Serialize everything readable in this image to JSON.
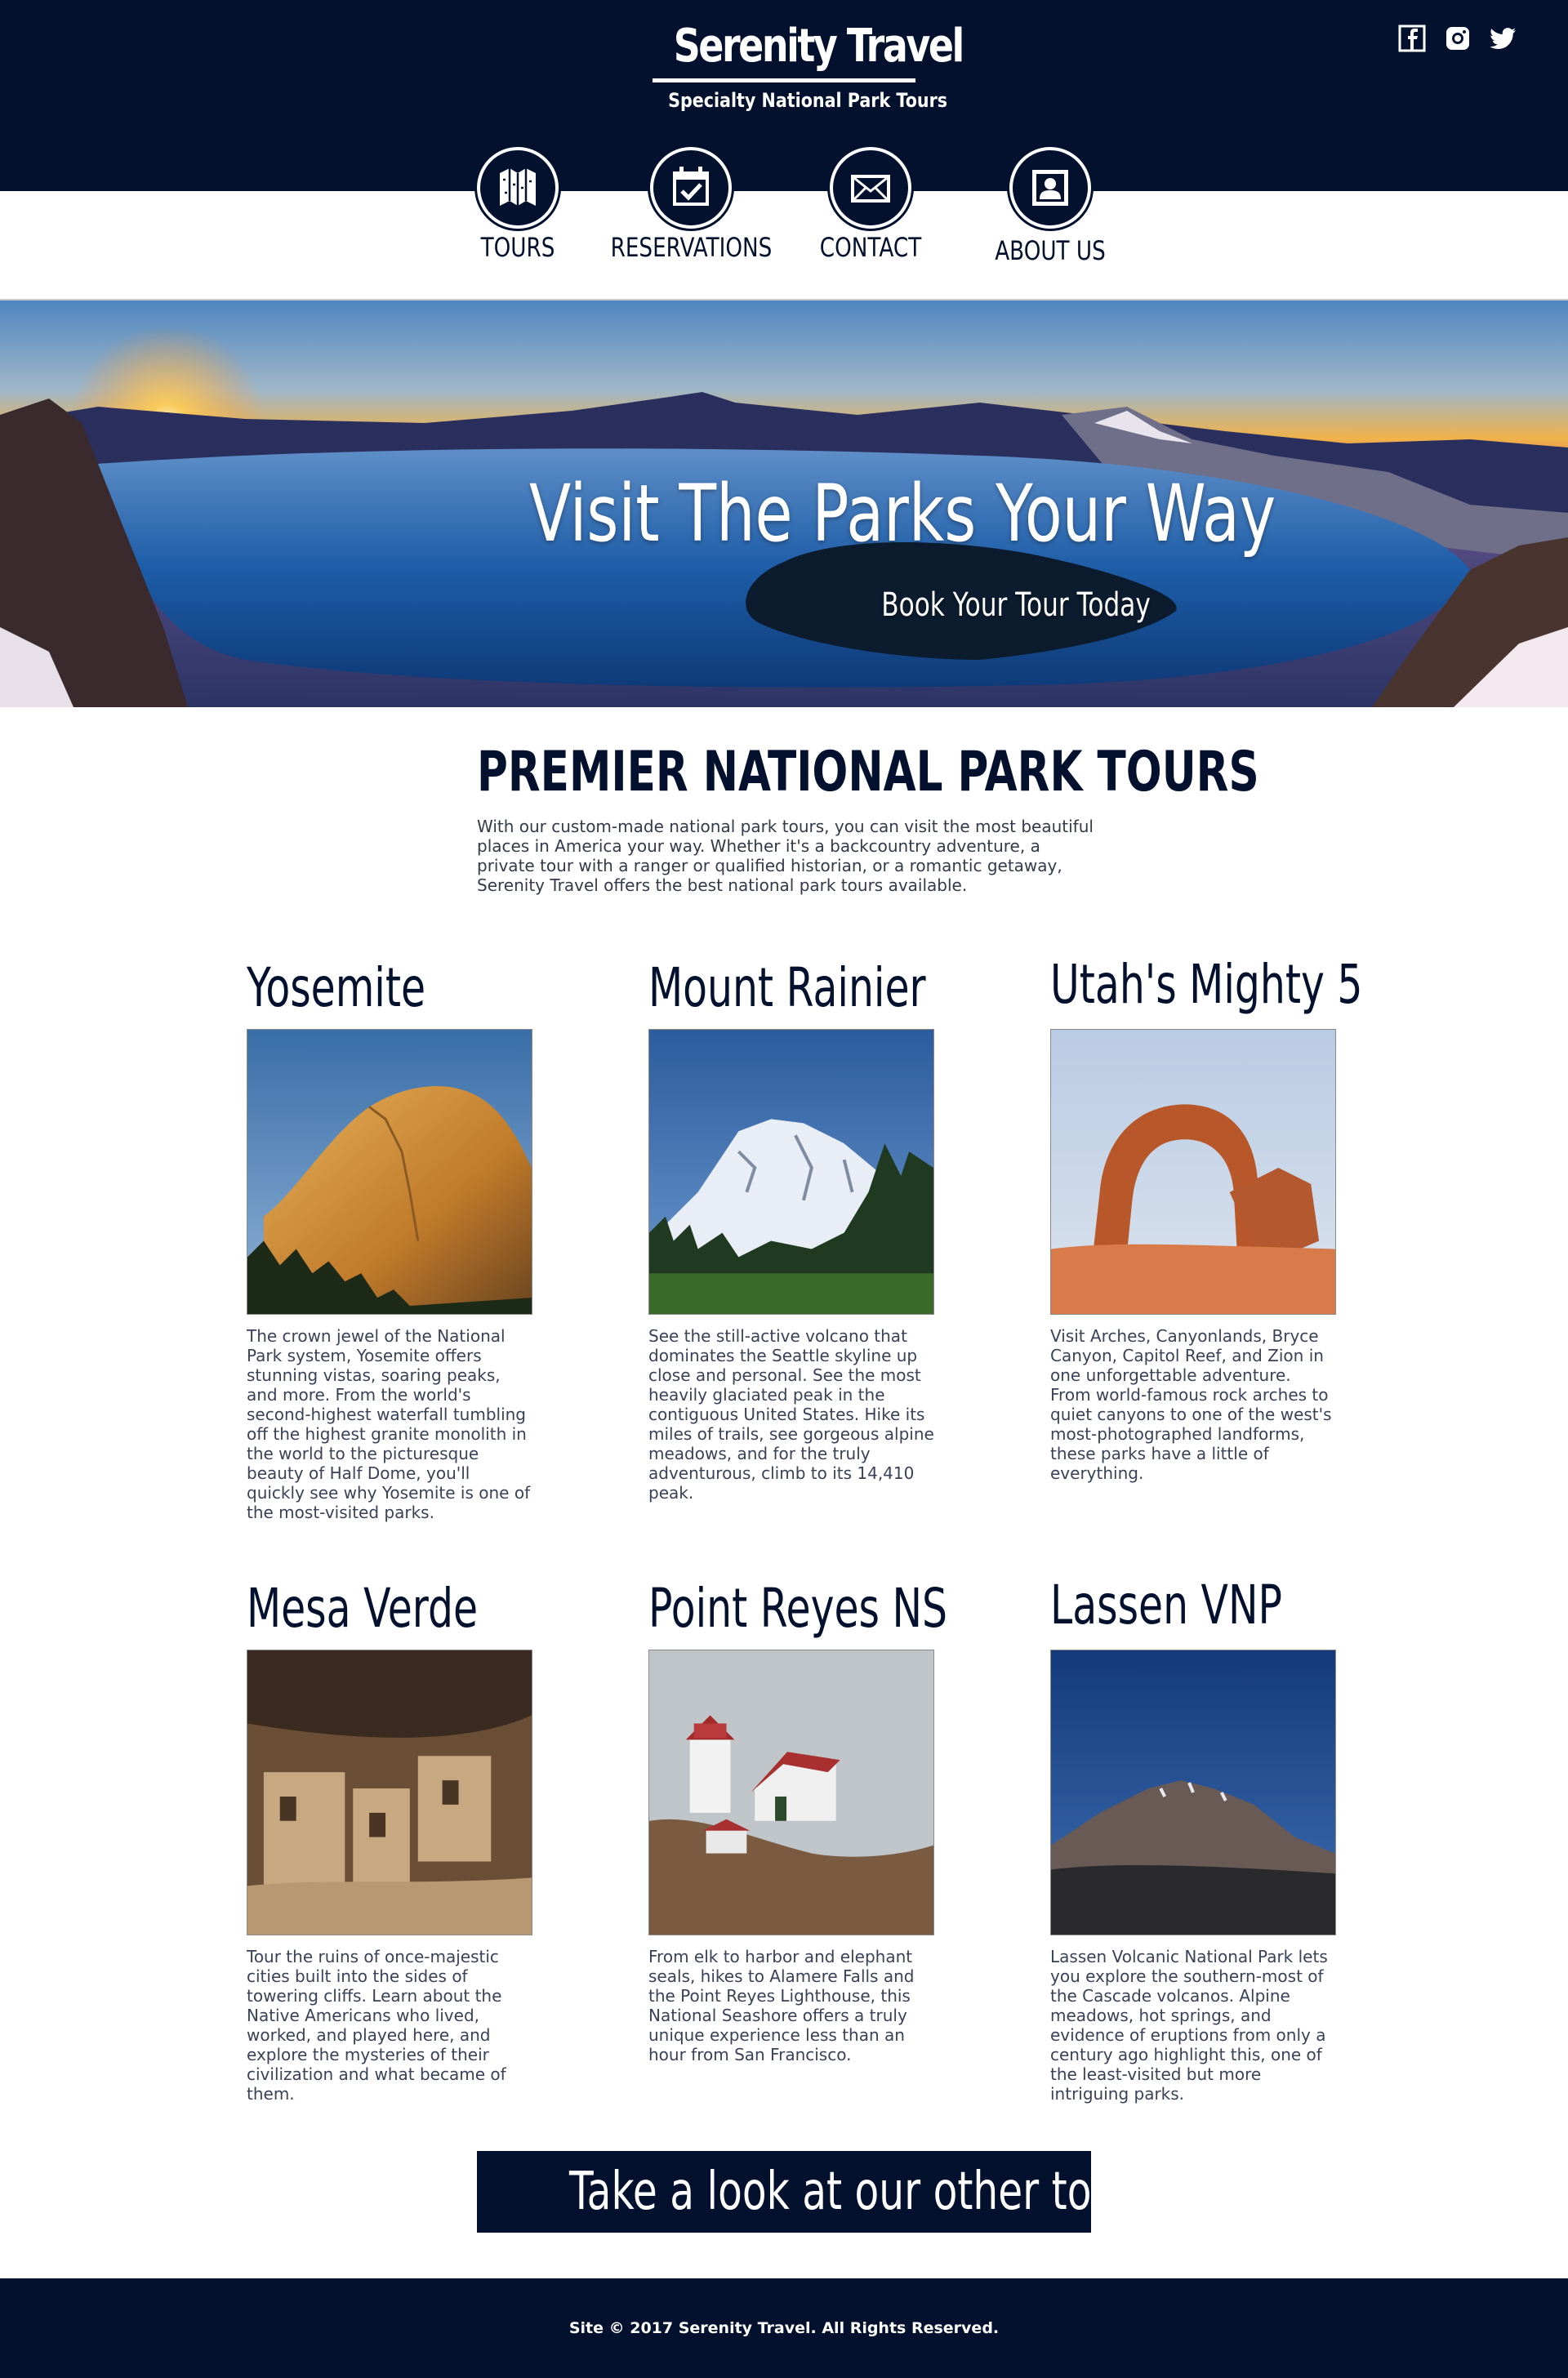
{
  "brand": {
    "title": "Serenity Travel",
    "tagline": "Specialty National Park Tours"
  },
  "social": [
    "facebook-icon",
    "instagram-icon",
    "twitter-icon"
  ],
  "nav": [
    {
      "label": "TOURS",
      "icon": "map-icon"
    },
    {
      "label": "RESERVATIONS",
      "icon": "calendar-check-icon"
    },
    {
      "label": "CONTACT",
      "icon": "envelope-icon"
    },
    {
      "label": "ABOUT US",
      "icon": "person-icon"
    }
  ],
  "hero": {
    "title": "Visit The Parks Your Way",
    "subtitle": "Book Your Tour Today"
  },
  "intro": {
    "title": "PREMIER NATIONAL PARK TOURS",
    "text": "With our custom-made national park tours, you can visit the most beautiful places in America your way. Whether it's a backcountry adventure, a private tour with a ranger or qualified historian, or a romantic getaway, Serenity Travel offers the best national park tours available."
  },
  "parks": [
    {
      "name": "Yosemite",
      "text": "The crown jewel of the National Park system, Yosemite offers stunning vistas, soaring peaks, and more. From the world's second-highest waterfall tumbling off the highest granite monolith in the world to the picturesque beauty of Half Dome, you'll quickly see why Yosemite is one of the most-visited parks."
    },
    {
      "name": "Mount Rainier",
      "text": "See the still-active volcano that dominates the Seattle skyline up close and personal. See the most heavily glaciated peak in the contiguous United States. Hike its miles of trails, see gorgeous alpine meadows, and for the truly adventurous, climb to its 14,410 peak."
    },
    {
      "name": "Utah's Mighty 5",
      "text": "Visit Arches, Canyonlands, Bryce Canyon, Capitol Reef, and Zion in one unforgettable adventure. From world-famous rock arches to quiet canyons to one of the west's most-photographed landforms, these parks have a little of everything."
    },
    {
      "name": "Mesa Verde",
      "text": "Tour the ruins of once-majestic cities built into the sides of towering cliffs. Learn about the Native Americans who lived, worked, and played here, and explore the mysteries of their civilization and what became of them."
    },
    {
      "name": "Point Reyes NS",
      "text": "From elk to harbor and elephant seals, hikes to Alamere Falls and the Point Reyes Lighthouse, this National Seashore offers a truly unique experience less than an hour from San Francisco."
    },
    {
      "name": "Lassen VNP",
      "text": "Lassen Volcanic National Park lets you explore the southern-most of the Cascade volcanos. Alpine meadows, hot springs, and evidence of eruptions from only a century ago highlight this, one of the least-visited but more intriguing parks."
    }
  ],
  "cta": {
    "label": "Take a look at our other tours"
  },
  "footer": {
    "text": "Site © 2017 Serenity Travel. All Rights Reserved."
  },
  "colors": {
    "navy": "#03112e",
    "white": "#ffffff"
  }
}
